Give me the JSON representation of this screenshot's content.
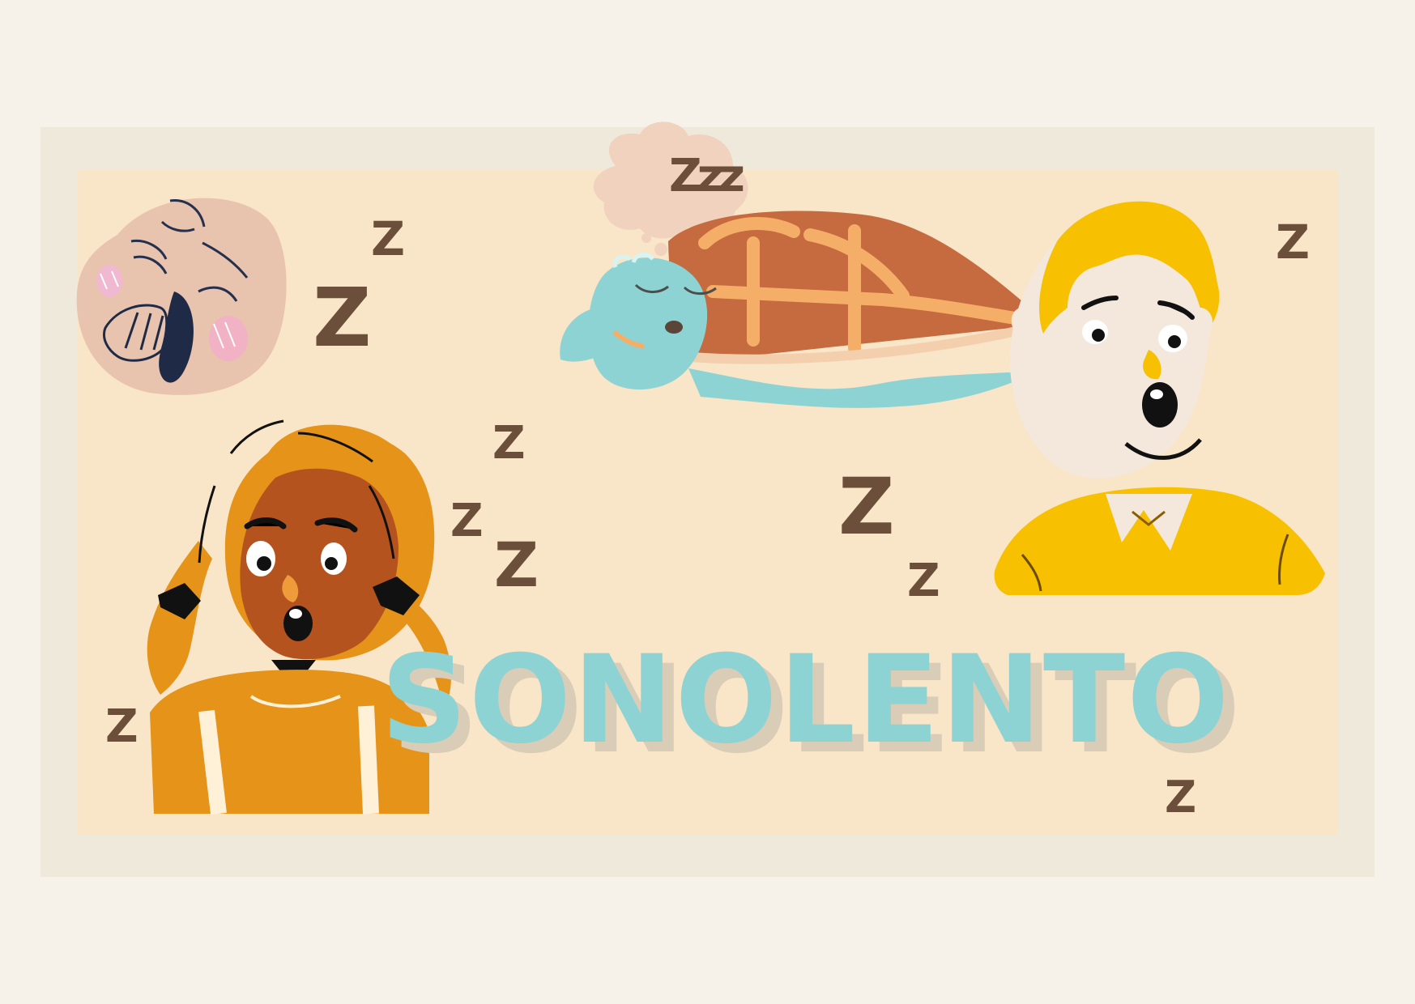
{
  "title": {
    "word": "SONOLENTO"
  },
  "sleep_marks": {
    "big_z": "Z",
    "small_z": "Z",
    "cloud_text": "Zzz"
  },
  "colors": {
    "background": "#f6f2ea",
    "frame": "#efe9dc",
    "panel": "#f9e5c7",
    "title": "#8ed3d3",
    "title_shadow": "#d9cdb8",
    "z_marks": "#6b4f3b",
    "turtle_skin": "#8ed3d3",
    "turtle_shell": "#c56b3f",
    "girl_hair": "#e59319",
    "boy_hair": "#f7c000",
    "baby_skin": "#e8c3ae"
  },
  "icons": {
    "baby": "yawning-baby-icon",
    "turtle": "sleeping-turtle-icon",
    "boy": "yawning-boy-icon",
    "girl": "yawning-girl-icon"
  }
}
